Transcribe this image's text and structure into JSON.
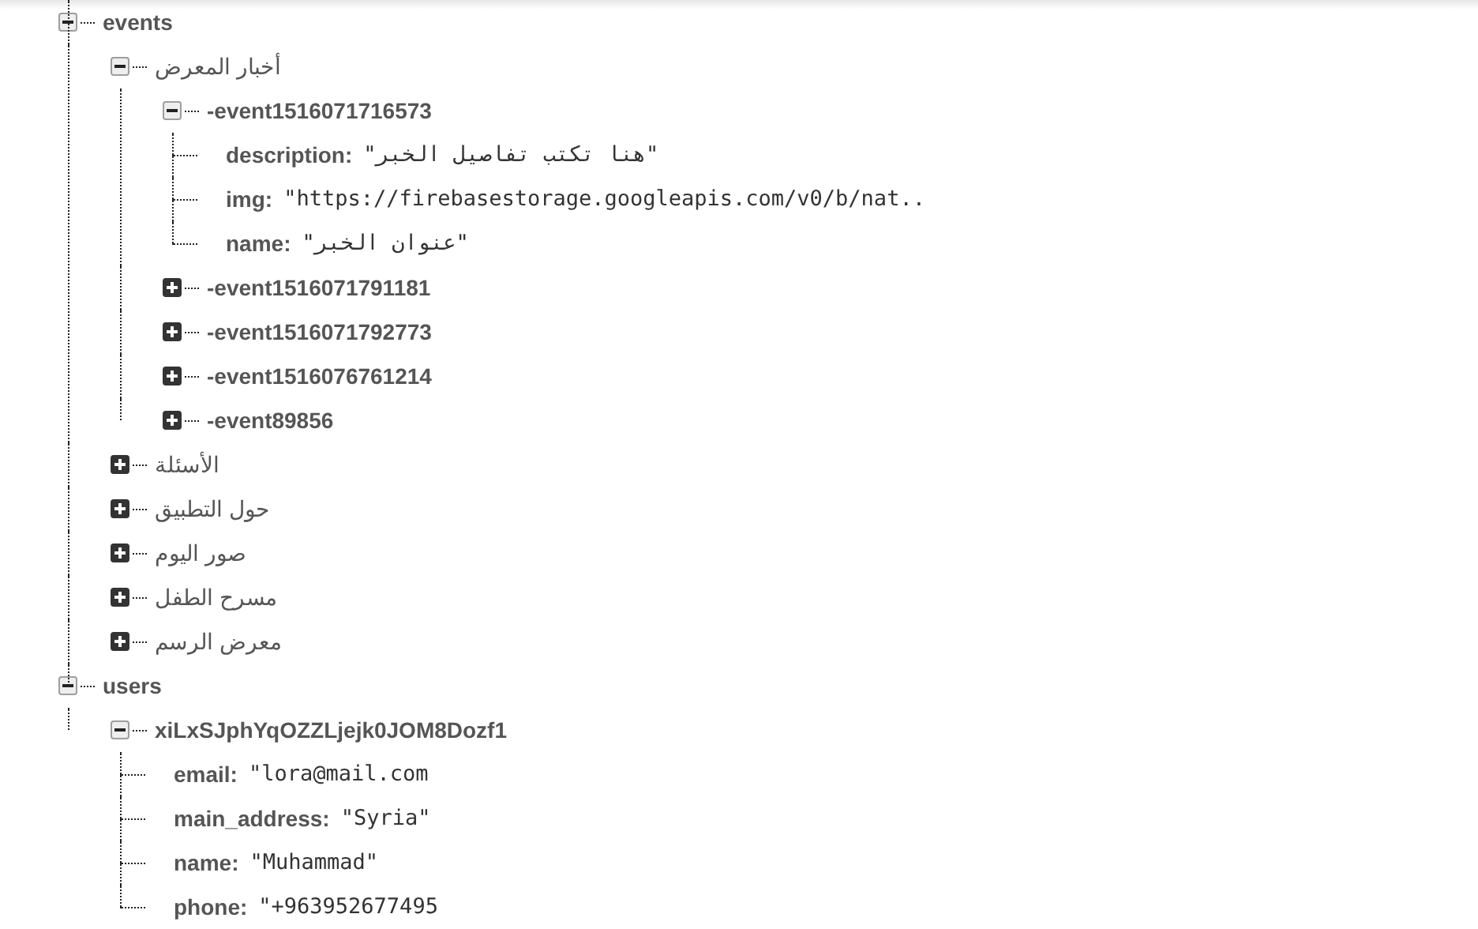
{
  "tree": [
    {
      "kind": "node",
      "key": "events",
      "expanded": true,
      "children": [
        {
          "kind": "node",
          "key": "أخبار المعرض",
          "expanded": true,
          "children": [
            {
              "kind": "node",
              "key": "-event1516071716573",
              "expanded": true,
              "children": [
                {
                  "kind": "leaf",
                  "key": "description:",
                  "value": "\"هنا تكتب تفاصيل الخبر\""
                },
                {
                  "kind": "leaf",
                  "key": "img:",
                  "value": "\"https://firebasestorage.googleapis.com/v0/b/nat.."
                },
                {
                  "kind": "leaf",
                  "key": "name:",
                  "value": "\"عنوان الخبر\""
                }
              ]
            },
            {
              "kind": "node",
              "key": "-event1516071791181",
              "expanded": false
            },
            {
              "kind": "node",
              "key": "-event1516071792773",
              "expanded": false
            },
            {
              "kind": "node",
              "key": "-event1516076761214",
              "expanded": false
            },
            {
              "kind": "node",
              "key": "-event89856",
              "expanded": false
            }
          ]
        },
        {
          "kind": "node",
          "key": "الأسئلة",
          "expanded": false
        },
        {
          "kind": "node",
          "key": "حول التطبيق",
          "expanded": false
        },
        {
          "kind": "node",
          "key": "صور اليوم",
          "expanded": false
        },
        {
          "kind": "node",
          "key": "مسرح الطفل",
          "expanded": false
        },
        {
          "kind": "node",
          "key": "معرض الرسم",
          "expanded": false
        }
      ]
    },
    {
      "kind": "node",
      "key": "users",
      "expanded": true,
      "children": [
        {
          "kind": "node",
          "key": "xiLxSJphYqOZZLjejk0JOM8Dozf1",
          "expanded": true,
          "children": [
            {
              "kind": "leaf",
              "key": "email:",
              "value": "\"lora@mail.com"
            },
            {
              "kind": "leaf",
              "key": "main_address:",
              "value": "\"Syria\""
            },
            {
              "kind": "leaf",
              "key": "name:",
              "value": "\"Muhammad\""
            },
            {
              "kind": "leaf",
              "key": "phone:",
              "value": "\"+963952677495"
            }
          ]
        }
      ]
    }
  ]
}
